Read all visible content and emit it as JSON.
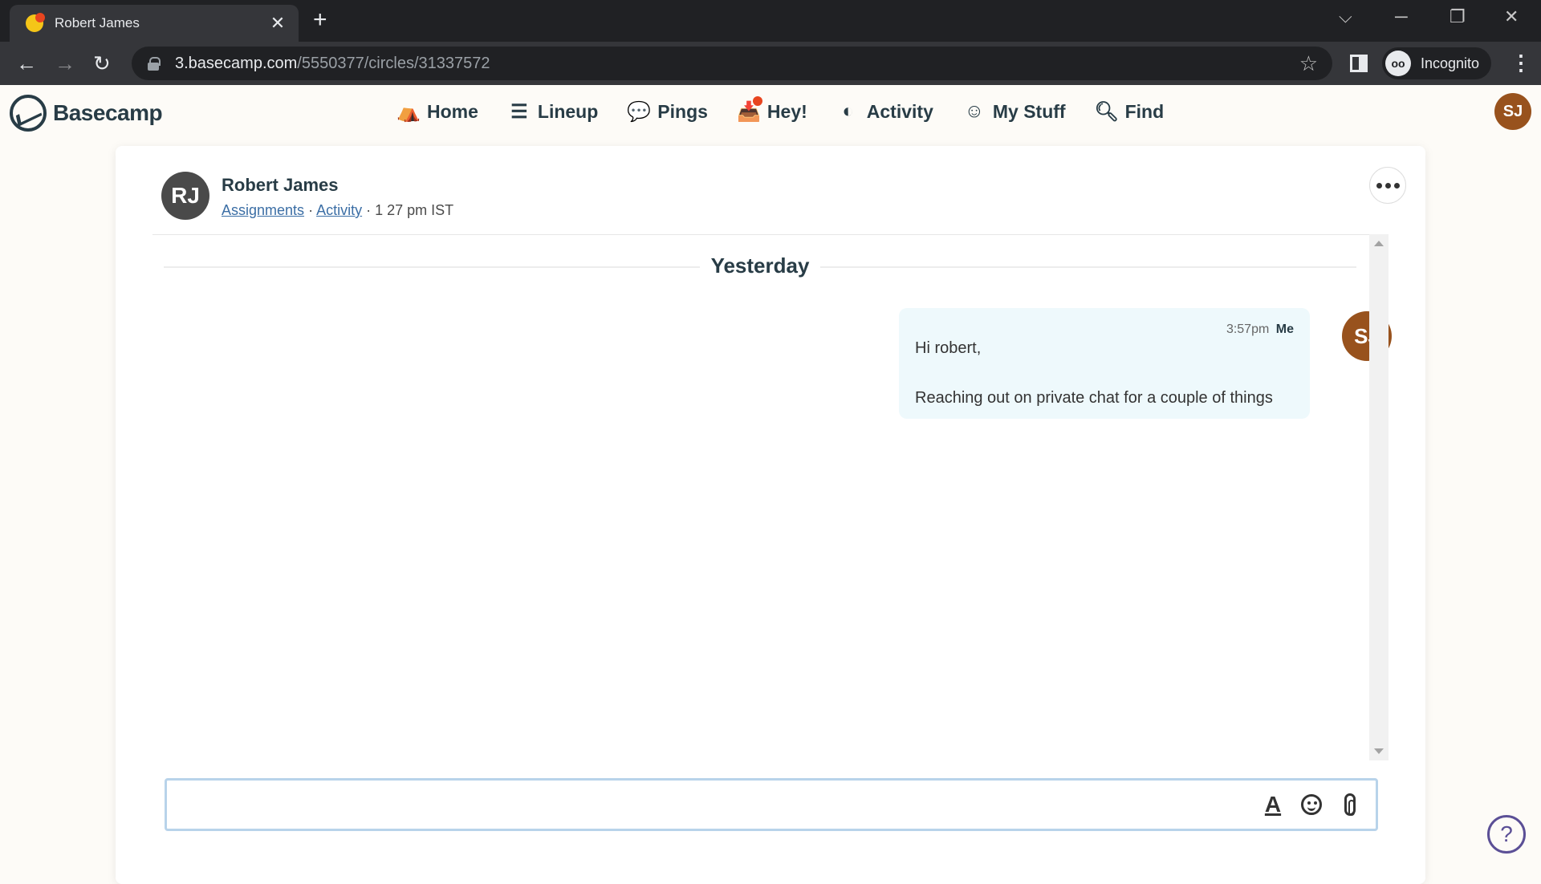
{
  "browser": {
    "tab_title": "Robert James",
    "url_host": "3.basecamp.com",
    "url_path": "/5550377/circles/31337572",
    "profile_label": "Incognito"
  },
  "app": {
    "brand": "Basecamp",
    "nav": [
      {
        "label": "Home",
        "icon": "home-icon"
      },
      {
        "label": "Lineup",
        "icon": "lineup-icon"
      },
      {
        "label": "Pings",
        "icon": "pings-icon"
      },
      {
        "label": "Hey!",
        "icon": "hey-inbox-icon",
        "has_notification": true
      },
      {
        "label": "Activity",
        "icon": "activity-icon"
      },
      {
        "label": "My Stuff",
        "icon": "smiley-icon"
      },
      {
        "label": "Find",
        "icon": "search-icon"
      }
    ],
    "user_initials": "SJ",
    "user_avatar_color": "#98521d"
  },
  "conversation": {
    "person_initials": "RJ",
    "person_name": "Robert James",
    "links": [
      "Assignments",
      "Activity"
    ],
    "local_time": "1 27 pm IST",
    "day_label": "Yesterday",
    "messages": [
      {
        "time": "3:57pm",
        "author": "Me",
        "author_initials": "SJ",
        "lines": [
          "Hi robert,",
          "Reaching out on private chat for a couple of things"
        ]
      }
    ]
  },
  "composer": {
    "value": "",
    "placeholder": ""
  },
  "help": {
    "label": "?"
  }
}
